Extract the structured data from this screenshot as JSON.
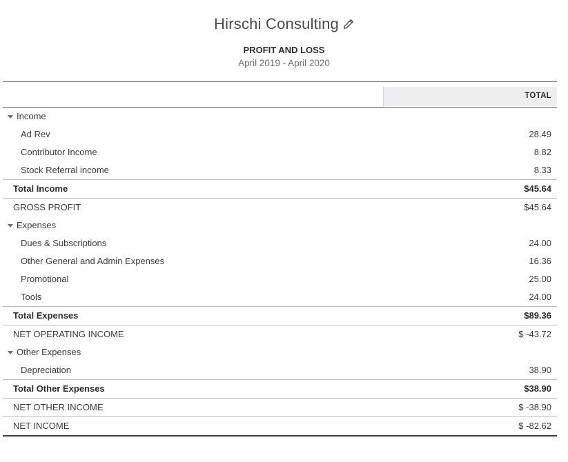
{
  "report": {
    "company": "Hirschi Consulting",
    "title": "PROFIT AND LOSS",
    "date_range": "April 2019 - April 2020",
    "column_header": "TOTAL"
  },
  "rows": [
    {
      "type": "section",
      "label": "Income",
      "amount": ""
    },
    {
      "type": "item",
      "label": "Ad Rev",
      "amount": "28.49"
    },
    {
      "type": "item",
      "label": "Contributor Income",
      "amount": "8.82"
    },
    {
      "type": "item",
      "label": "Stock Referral income",
      "amount": "8.33"
    },
    {
      "type": "total-bold",
      "label": "Total Income",
      "amount": "$45.64"
    },
    {
      "type": "total-plain",
      "label": "GROSS PROFIT",
      "amount": "$45.64"
    },
    {
      "type": "section",
      "label": "Expenses",
      "amount": ""
    },
    {
      "type": "item",
      "label": "Dues & Subscriptions",
      "amount": "24.00"
    },
    {
      "type": "item",
      "label": "Other General and Admin Expenses",
      "amount": "16.36"
    },
    {
      "type": "item",
      "label": "Promotional",
      "amount": "25.00"
    },
    {
      "type": "item",
      "label": "Tools",
      "amount": "24.00"
    },
    {
      "type": "total-bold",
      "label": "Total Expenses",
      "amount": "$89.36"
    },
    {
      "type": "total-plain",
      "label": "NET OPERATING INCOME",
      "amount": "$ -43.72"
    },
    {
      "type": "section",
      "label": "Other Expenses",
      "amount": ""
    },
    {
      "type": "item",
      "label": "Depreciation",
      "amount": "38.90"
    },
    {
      "type": "total-bold",
      "label": "Total Other Expenses",
      "amount": "$38.90"
    },
    {
      "type": "total-plain",
      "label": "NET OTHER INCOME",
      "amount": "$ -38.90"
    },
    {
      "type": "final",
      "label": "NET INCOME",
      "amount": "$ -82.62"
    }
  ],
  "icons": {
    "edit": "pencil-icon",
    "collapse": "caret-down-icon"
  }
}
